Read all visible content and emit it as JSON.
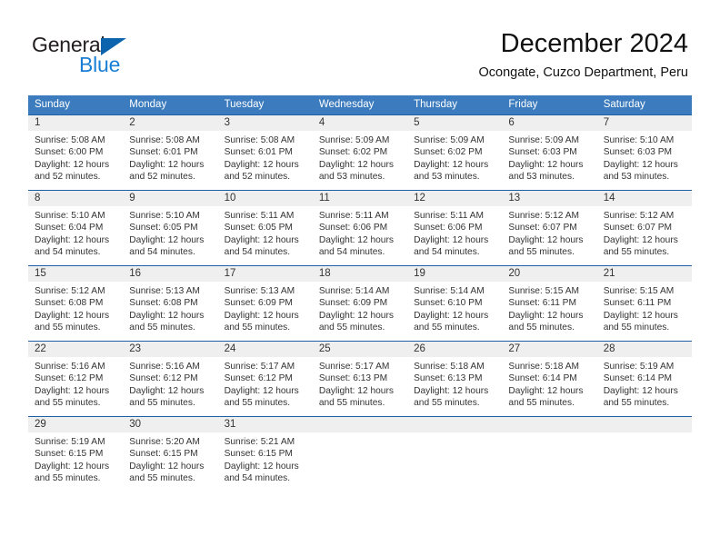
{
  "brand": {
    "name_part1": "General",
    "name_part2": "Blue",
    "triangle_icon": "triangle-icon",
    "color_dark": "#231f20",
    "color_blue": "#1a7fd4"
  },
  "header": {
    "title": "December 2024",
    "subtitle": "Ocongate, Cuzco Department, Peru"
  },
  "theme": {
    "header_row_bg": "#3c7cbe",
    "cell_border": "#1f5fa8",
    "daynum_band_bg": "#efefef",
    "text": "#333333"
  },
  "calendar": {
    "weekday_headers": [
      "Sunday",
      "Monday",
      "Tuesday",
      "Wednesday",
      "Thursday",
      "Friday",
      "Saturday"
    ],
    "weeks": [
      [
        {
          "day": "1",
          "sunrise": "Sunrise: 5:08 AM",
          "sunset": "Sunset: 6:00 PM",
          "daylight": "Daylight: 12 hours and 52 minutes."
        },
        {
          "day": "2",
          "sunrise": "Sunrise: 5:08 AM",
          "sunset": "Sunset: 6:01 PM",
          "daylight": "Daylight: 12 hours and 52 minutes."
        },
        {
          "day": "3",
          "sunrise": "Sunrise: 5:08 AM",
          "sunset": "Sunset: 6:01 PM",
          "daylight": "Daylight: 12 hours and 52 minutes."
        },
        {
          "day": "4",
          "sunrise": "Sunrise: 5:09 AM",
          "sunset": "Sunset: 6:02 PM",
          "daylight": "Daylight: 12 hours and 53 minutes."
        },
        {
          "day": "5",
          "sunrise": "Sunrise: 5:09 AM",
          "sunset": "Sunset: 6:02 PM",
          "daylight": "Daylight: 12 hours and 53 minutes."
        },
        {
          "day": "6",
          "sunrise": "Sunrise: 5:09 AM",
          "sunset": "Sunset: 6:03 PM",
          "daylight": "Daylight: 12 hours and 53 minutes."
        },
        {
          "day": "7",
          "sunrise": "Sunrise: 5:10 AM",
          "sunset": "Sunset: 6:03 PM",
          "daylight": "Daylight: 12 hours and 53 minutes."
        }
      ],
      [
        {
          "day": "8",
          "sunrise": "Sunrise: 5:10 AM",
          "sunset": "Sunset: 6:04 PM",
          "daylight": "Daylight: 12 hours and 54 minutes."
        },
        {
          "day": "9",
          "sunrise": "Sunrise: 5:10 AM",
          "sunset": "Sunset: 6:05 PM",
          "daylight": "Daylight: 12 hours and 54 minutes."
        },
        {
          "day": "10",
          "sunrise": "Sunrise: 5:11 AM",
          "sunset": "Sunset: 6:05 PM",
          "daylight": "Daylight: 12 hours and 54 minutes."
        },
        {
          "day": "11",
          "sunrise": "Sunrise: 5:11 AM",
          "sunset": "Sunset: 6:06 PM",
          "daylight": "Daylight: 12 hours and 54 minutes."
        },
        {
          "day": "12",
          "sunrise": "Sunrise: 5:11 AM",
          "sunset": "Sunset: 6:06 PM",
          "daylight": "Daylight: 12 hours and 54 minutes."
        },
        {
          "day": "13",
          "sunrise": "Sunrise: 5:12 AM",
          "sunset": "Sunset: 6:07 PM",
          "daylight": "Daylight: 12 hours and 55 minutes."
        },
        {
          "day": "14",
          "sunrise": "Sunrise: 5:12 AM",
          "sunset": "Sunset: 6:07 PM",
          "daylight": "Daylight: 12 hours and 55 minutes."
        }
      ],
      [
        {
          "day": "15",
          "sunrise": "Sunrise: 5:12 AM",
          "sunset": "Sunset: 6:08 PM",
          "daylight": "Daylight: 12 hours and 55 minutes."
        },
        {
          "day": "16",
          "sunrise": "Sunrise: 5:13 AM",
          "sunset": "Sunset: 6:08 PM",
          "daylight": "Daylight: 12 hours and 55 minutes."
        },
        {
          "day": "17",
          "sunrise": "Sunrise: 5:13 AM",
          "sunset": "Sunset: 6:09 PM",
          "daylight": "Daylight: 12 hours and 55 minutes."
        },
        {
          "day": "18",
          "sunrise": "Sunrise: 5:14 AM",
          "sunset": "Sunset: 6:09 PM",
          "daylight": "Daylight: 12 hours and 55 minutes."
        },
        {
          "day": "19",
          "sunrise": "Sunrise: 5:14 AM",
          "sunset": "Sunset: 6:10 PM",
          "daylight": "Daylight: 12 hours and 55 minutes."
        },
        {
          "day": "20",
          "sunrise": "Sunrise: 5:15 AM",
          "sunset": "Sunset: 6:11 PM",
          "daylight": "Daylight: 12 hours and 55 minutes."
        },
        {
          "day": "21",
          "sunrise": "Sunrise: 5:15 AM",
          "sunset": "Sunset: 6:11 PM",
          "daylight": "Daylight: 12 hours and 55 minutes."
        }
      ],
      [
        {
          "day": "22",
          "sunrise": "Sunrise: 5:16 AM",
          "sunset": "Sunset: 6:12 PM",
          "daylight": "Daylight: 12 hours and 55 minutes."
        },
        {
          "day": "23",
          "sunrise": "Sunrise: 5:16 AM",
          "sunset": "Sunset: 6:12 PM",
          "daylight": "Daylight: 12 hours and 55 minutes."
        },
        {
          "day": "24",
          "sunrise": "Sunrise: 5:17 AM",
          "sunset": "Sunset: 6:12 PM",
          "daylight": "Daylight: 12 hours and 55 minutes."
        },
        {
          "day": "25",
          "sunrise": "Sunrise: 5:17 AM",
          "sunset": "Sunset: 6:13 PM",
          "daylight": "Daylight: 12 hours and 55 minutes."
        },
        {
          "day": "26",
          "sunrise": "Sunrise: 5:18 AM",
          "sunset": "Sunset: 6:13 PM",
          "daylight": "Daylight: 12 hours and 55 minutes."
        },
        {
          "day": "27",
          "sunrise": "Sunrise: 5:18 AM",
          "sunset": "Sunset: 6:14 PM",
          "daylight": "Daylight: 12 hours and 55 minutes."
        },
        {
          "day": "28",
          "sunrise": "Sunrise: 5:19 AM",
          "sunset": "Sunset: 6:14 PM",
          "daylight": "Daylight: 12 hours and 55 minutes."
        }
      ],
      [
        {
          "day": "29",
          "sunrise": "Sunrise: 5:19 AM",
          "sunset": "Sunset: 6:15 PM",
          "daylight": "Daylight: 12 hours and 55 minutes."
        },
        {
          "day": "30",
          "sunrise": "Sunrise: 5:20 AM",
          "sunset": "Sunset: 6:15 PM",
          "daylight": "Daylight: 12 hours and 55 minutes."
        },
        {
          "day": "31",
          "sunrise": "Sunrise: 5:21 AM",
          "sunset": "Sunset: 6:15 PM",
          "daylight": "Daylight: 12 hours and 54 minutes."
        },
        {
          "day": "",
          "sunrise": "",
          "sunset": "",
          "daylight": ""
        },
        {
          "day": "",
          "sunrise": "",
          "sunset": "",
          "daylight": ""
        },
        {
          "day": "",
          "sunrise": "",
          "sunset": "",
          "daylight": ""
        },
        {
          "day": "",
          "sunrise": "",
          "sunset": "",
          "daylight": ""
        }
      ]
    ]
  }
}
